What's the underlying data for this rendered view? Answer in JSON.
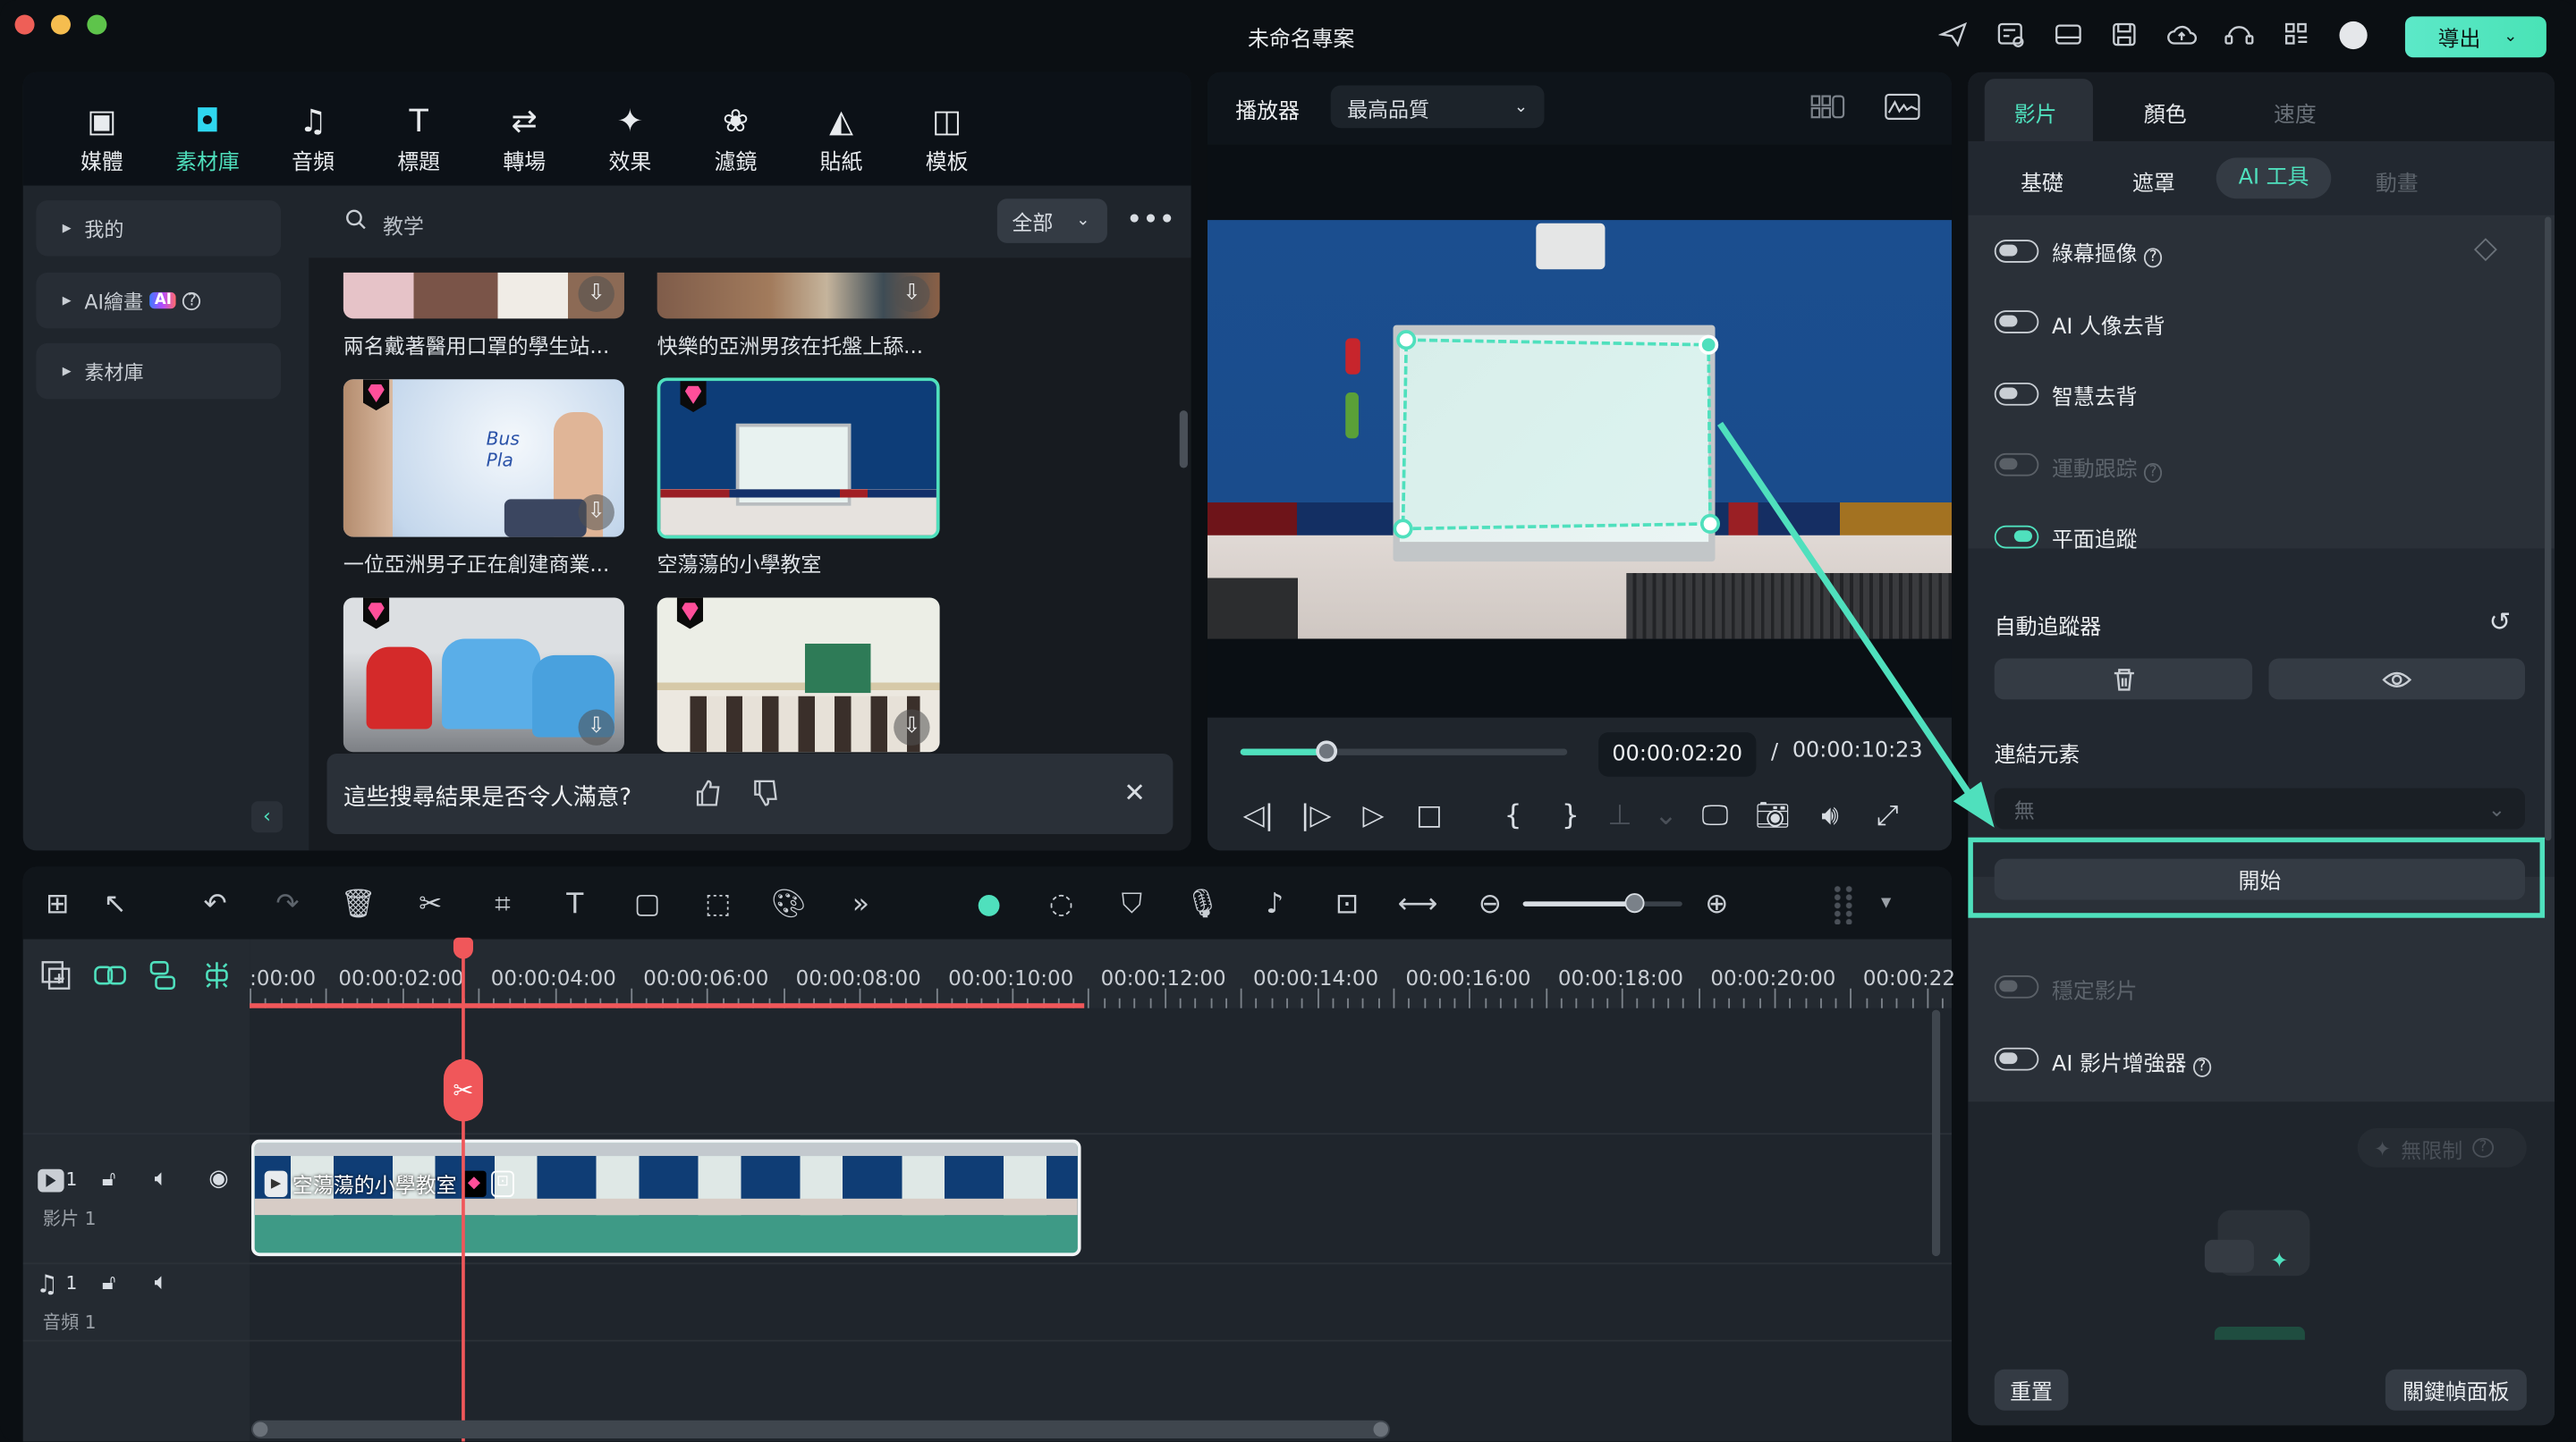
{
  "window": {
    "title": "未命名專案",
    "export_label": "導出",
    "accent": "#4fe0bd"
  },
  "left_tabs": [
    {
      "label": "媒體",
      "icon": "media-icon"
    },
    {
      "label": "素材庫",
      "icon": "stock-folder-icon",
      "active": true
    },
    {
      "label": "音頻",
      "icon": "music-note-icon"
    },
    {
      "label": "標題",
      "icon": "title-t-icon"
    },
    {
      "label": "轉場",
      "icon": "transition-icon"
    },
    {
      "label": "效果",
      "icon": "effects-star-icon"
    },
    {
      "label": "濾鏡",
      "icon": "filter-circles-icon"
    },
    {
      "label": "貼紙",
      "icon": "sticker-icon"
    },
    {
      "label": "模板",
      "icon": "template-icon"
    }
  ],
  "sidebar": {
    "items": [
      {
        "label": "我的"
      },
      {
        "label": "AI繪畫",
        "badge": "AI"
      },
      {
        "label": "素材庫"
      }
    ]
  },
  "search": {
    "value": "教学",
    "filter": "全部"
  },
  "results": [
    {
      "caption": "兩名戴著醫用口罩的學生站..."
    },
    {
      "caption": "快樂的亞洲男孩在托盤上舔..."
    },
    {
      "caption": "一位亞洲男子正在創建商業...",
      "premium": true
    },
    {
      "caption": "空蕩蕩的小學教室",
      "premium": true,
      "selected": true
    },
    {
      "caption": "",
      "premium": true
    },
    {
      "caption": "",
      "premium": true
    }
  ],
  "feedback": {
    "question": "這些搜尋結果是否令人滿意?"
  },
  "player": {
    "label": "播放器",
    "quality": "最高品質",
    "current_time": "00:00:02:20",
    "separator": "/",
    "total_time": "00:00:10:23",
    "progress": 0.26
  },
  "right_panel": {
    "tabs": [
      {
        "label": "影片",
        "active": true
      },
      {
        "label": "顏色"
      },
      {
        "label": "速度",
        "disabled": true
      }
    ],
    "subtabs": [
      {
        "label": "基礎"
      },
      {
        "label": "遮罩"
      },
      {
        "label": "AI 工具",
        "active": true
      },
      {
        "label": "動畫",
        "disabled": true
      }
    ],
    "toggles": [
      {
        "label": "綠幕摳像",
        "on": false,
        "help": true
      },
      {
        "label": "AI 人像去背",
        "on": false
      },
      {
        "label": "智慧去背",
        "on": false
      },
      {
        "label": "運動跟踪",
        "on": false,
        "disabled": true,
        "help": true
      },
      {
        "label": "平面追蹤",
        "on": true
      }
    ],
    "auto_tracker": "自動追蹤器",
    "link_element": "連結元素",
    "link_value": "無",
    "start_button": "開始",
    "toggles2": [
      {
        "label": "穩定影片",
        "on": false,
        "disabled": true
      },
      {
        "label": "AI 影片增強器",
        "on": false,
        "help": true
      }
    ],
    "unlimited": "無限制",
    "reset": "重置",
    "keyframe_panel": "關鍵幀面板"
  },
  "timeline": {
    "ticks": [
      ":00:00",
      "00:00:02:00",
      "00:00:04:00",
      "00:00:06:00",
      "00:00:08:00",
      "00:00:10:00",
      "00:00:12:00",
      "00:00:14:00",
      "00:00:16:00",
      "00:00:18:00",
      "00:00:20:00",
      "00:00:22"
    ],
    "zoom_level": 0.7,
    "video_track": {
      "num": "1",
      "name": "影片 1",
      "clip": "空蕩蕩的小學教室"
    },
    "audio_track": {
      "num": "1",
      "name": "音頻 1"
    }
  }
}
